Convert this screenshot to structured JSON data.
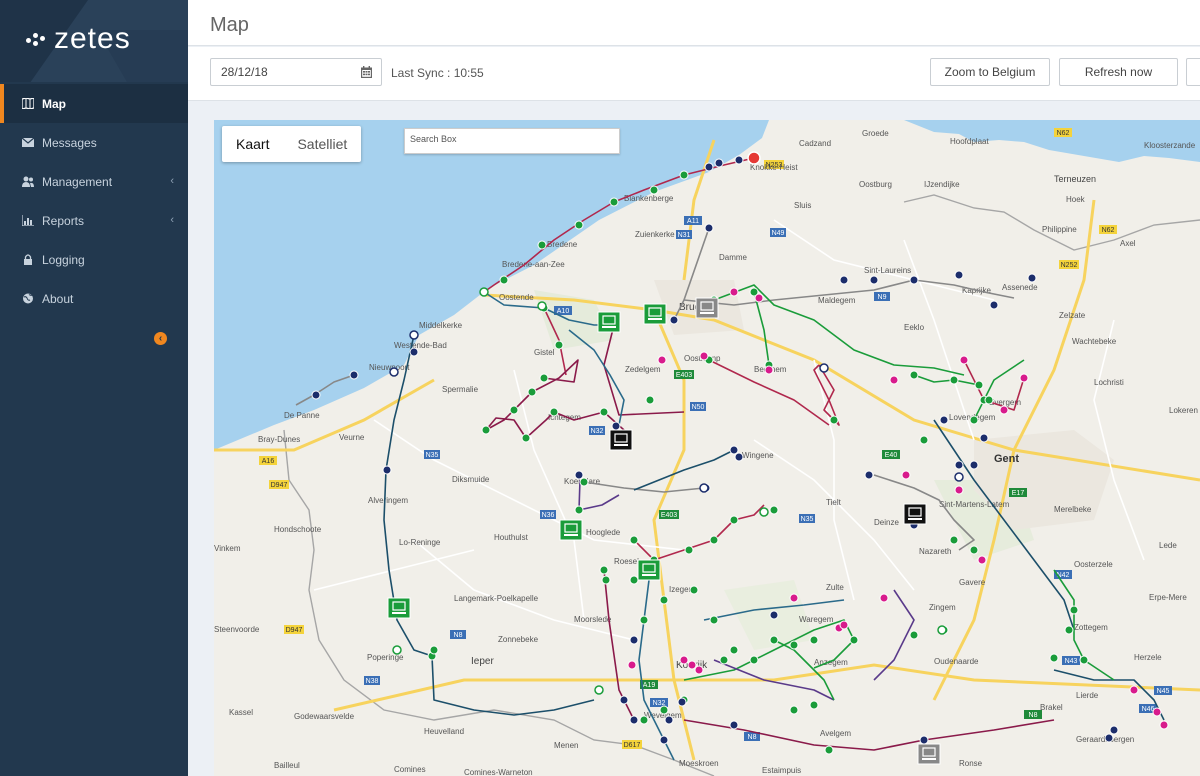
{
  "app": {
    "logo_text": "zetes"
  },
  "sidebar": {
    "items": [
      {
        "label": "Map",
        "icon": "map-icon",
        "active": true,
        "has_submenu": false
      },
      {
        "label": "Messages",
        "icon": "envelope-icon",
        "active": false,
        "has_submenu": false
      },
      {
        "label": "Management",
        "icon": "users-icon",
        "active": false,
        "has_submenu": true
      },
      {
        "label": "Reports",
        "icon": "bar-chart-icon",
        "active": false,
        "has_submenu": true
      },
      {
        "label": "Logging",
        "icon": "lock-icon",
        "active": false,
        "has_submenu": false
      },
      {
        "label": "About",
        "icon": "globe-icon",
        "active": false,
        "has_submenu": false
      }
    ],
    "collapse_icon": "arrow-left-circle-icon"
  },
  "header": {
    "title": "Map"
  },
  "toolbar": {
    "date_value": "28/12/18",
    "calendar_icon": "calendar-icon",
    "last_sync": "Last Sync : 10:55",
    "zoom_button": "Zoom to Belgium",
    "refresh_button": "Refresh now"
  },
  "map": {
    "type_buttons": [
      "Kaart",
      "Satelliet"
    ],
    "search_placeholder": "Search Box",
    "labels": [
      "Knokke-Heist",
      "Cadzand",
      "Groede",
      "Hoofdplaat",
      "Terneuzen",
      "Kloosterzande",
      "Oostburg",
      "IJzendijke",
      "Hoek",
      "Philippine",
      "Axel",
      "Blankenberge",
      "Zuienkerke",
      "Damme",
      "Sluis",
      "Sint-Laureins",
      "Kaprijke",
      "Assenede",
      "Zelzate",
      "Wachtebeke",
      "Bredene",
      "Bredene-aan-Zee",
      "Oostende",
      "Middelkerke",
      "Westende-Bad",
      "Nieuwpoort",
      "Gistel",
      "Brugge",
      "Maldegem",
      "Eeklo",
      "Oostkamp",
      "Zedelgem",
      "Beernem",
      "Spermalie",
      "Ichtegem",
      "Lovendegem",
      "Evergem",
      "Lochristi",
      "Lokeren",
      "De Panne",
      "Veurne",
      "Bray-Dunes",
      "Diksmuide",
      "Koekelare",
      "Wingene",
      "Tielt",
      "Gent",
      "Deinze",
      "Sint-Martens-Latem",
      "Merelbeke",
      "Hondschoote",
      "Alveringem",
      "Lo-Reninge",
      "Houthulst",
      "Hooglede",
      "Roeselare",
      "Nazareth",
      "Gavere",
      "Oosterzele",
      "Lede",
      "Vinkem",
      "Langemark-Poelkapelle",
      "Izegem",
      "Zulte",
      "Zingem",
      "Erpe-Mere",
      "Zonnebeke",
      "Moorslede",
      "Waregem",
      "Zottegem",
      "Poperinge",
      "Ieper",
      "Kortrijk",
      "Anzegem",
      "Oudenaarde",
      "Herzele",
      "Lierde",
      "Steenvoorde",
      "Godewaarsvelde",
      "Heuvelland",
      "Menen",
      "Wevelgem",
      "Avelgem",
      "Brakel",
      "Geraardsbergen",
      "Kassel",
      "Comines",
      "Moeskroen",
      "Estaimpuis",
      "Ronse",
      "Bailleul",
      "Comines-Warneton"
    ],
    "road_labels": [
      "N34",
      "E40",
      "A11",
      "N31",
      "N49",
      "N9",
      "N44",
      "A10",
      "E403",
      "N35",
      "N36",
      "N50",
      "E17",
      "N60",
      "N43",
      "N42",
      "N62",
      "N253",
      "N252",
      "N258",
      "N8",
      "N46",
      "N45",
      "D947",
      "A18"
    ],
    "marker_colors": {
      "green": "#1a9c3a",
      "navy": "#1c2d6b",
      "magenta": "#d81b8c",
      "red": "#e53935"
    }
  }
}
